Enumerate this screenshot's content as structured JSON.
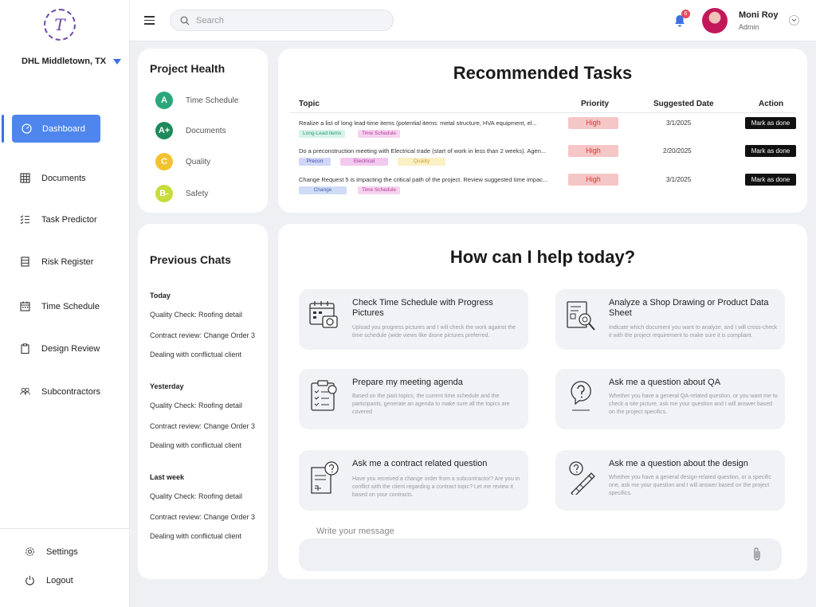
{
  "sidebar": {
    "logo_letter": "T",
    "location": "DHL Middletown, TX",
    "nav": [
      {
        "label": "Dashboard",
        "icon": "dashboard-icon"
      },
      {
        "label": "Documents",
        "icon": "grid-icon"
      },
      {
        "label": "Task Predictor",
        "icon": "checklist-icon"
      },
      {
        "label": "Risk Register",
        "icon": "register-icon"
      },
      {
        "label": "Time Schedule",
        "icon": "calendar-icon"
      },
      {
        "label": "Design Review",
        "icon": "clipboard-icon"
      },
      {
        "label": "Subcontractors",
        "icon": "users-icon"
      }
    ],
    "settings_label": "Settings",
    "logout_label": "Logout"
  },
  "topbar": {
    "search_placeholder": "Search",
    "notification_count": "6",
    "user_name": "Moni Roy",
    "user_role": "Admin"
  },
  "project_health": {
    "title": "Project Health",
    "items": [
      {
        "grade": "A",
        "label": "Time Schedule",
        "color": "#2aa87a"
      },
      {
        "grade": "A+",
        "label": "Documents",
        "color": "#1e8a5c"
      },
      {
        "grade": "C",
        "label": "Quality",
        "color": "#f2c230"
      },
      {
        "grade": "B-",
        "label": "Safety",
        "color": "#c8dc3a"
      }
    ]
  },
  "recommended_tasks": {
    "title": "Recommended Tasks",
    "headers": {
      "topic": "Topic",
      "priority": "Priority",
      "date": "Suggested Date",
      "action": "Action"
    },
    "rows": [
      {
        "topic": "Realize a list of long lead-time items (potential items: metal structure, HVA equipment, el...",
        "tags": [
          {
            "label": "Long-Lead items",
            "bg": "#d7f3ea",
            "fg": "#2a9d74"
          },
          {
            "label": "Time Schedule",
            "bg": "#f7d3ef",
            "fg": "#b23a98"
          }
        ],
        "priority": "High",
        "date": "3/1/2025",
        "action": "Mark as done"
      },
      {
        "topic": "Do a preconstruction meeting with Electrical trade (start of work in less than 2 weeks). Agen...",
        "tags": [
          {
            "label": "Precon",
            "bg": "#cfd6f7",
            "fg": "#3b4bb0"
          },
          {
            "label": "Electrical",
            "bg": "#f3c8ef",
            "fg": "#a83a9c"
          },
          {
            "label": "Quality",
            "bg": "#fbefc4",
            "fg": "#c9a43a"
          }
        ],
        "priority": "High",
        "date": "2/20/2025",
        "action": "Mark as done"
      },
      {
        "topic": "Change Request 5 is impacting the critical path of the project. Review suggested time impac...",
        "tags": [
          {
            "label": "Change",
            "bg": "#cfdcf5",
            "fg": "#3b5fb0"
          },
          {
            "label": "Time Schedule",
            "bg": "#f7d3ef",
            "fg": "#b23a98"
          }
        ],
        "priority": "High",
        "date": "3/1/2025",
        "action": "Mark as done"
      }
    ]
  },
  "previous_chats": {
    "title": "Previous Chats",
    "groups": [
      {
        "label": "Today",
        "items": [
          "Quality Check: Roofing detail",
          "Contract review: Change Order 3",
          "Dealing with conflictual client"
        ]
      },
      {
        "label": "Yesterday",
        "items": [
          "Quality Check: Roofing detail",
          "Contract review: Change Order 3",
          "Dealing with conflictual client"
        ]
      },
      {
        "label": "Last week",
        "items": [
          "Quality Check: Roofing detail",
          "Contract review: Change Order 3",
          "Dealing with conflictual client"
        ]
      }
    ]
  },
  "help": {
    "title": "How can I help today?",
    "options": [
      {
        "title": "Check Time Schedule with Progress Pictures",
        "desc": "Upload you progress pictures and I will check the work against the time schedule (wide views like drone pictures preferred.",
        "icon": "schedule-camera-icon"
      },
      {
        "title": "Analyze a Shop Drawing or Product Data Sheet",
        "desc": "Indicate which document you want to analyze, and I will cross-check it with the project requirement to make sure it is compliant.",
        "icon": "document-analysis-icon"
      },
      {
        "title": "Prepare my meeting agenda",
        "desc": "Based on the past topics; the current time schedule and the participants, generate an agenda to make sure all the topics are covered",
        "icon": "agenda-checklist-icon"
      },
      {
        "title": "Ask me a question about QA",
        "desc": "Whether you have a general QA-related question, or you want me to check a site picture, ask me your question and I will answer based on the project specifics.",
        "icon": "question-bubble-icon"
      },
      {
        "title": "Ask me a contract related question",
        "desc": "Have you received a change order from a subcontractor? Are you in conflict with the client regarding a contract topic? Let me review it based on your contracts.",
        "icon": "contract-question-icon"
      },
      {
        "title": "Ask me a question about the design",
        "desc": "Whether you have a general design-related question, or a specific one, ask me your question and I will answer based on the project specifics.",
        "icon": "design-question-icon"
      }
    ],
    "message_placeholder": "Write your message"
  }
}
